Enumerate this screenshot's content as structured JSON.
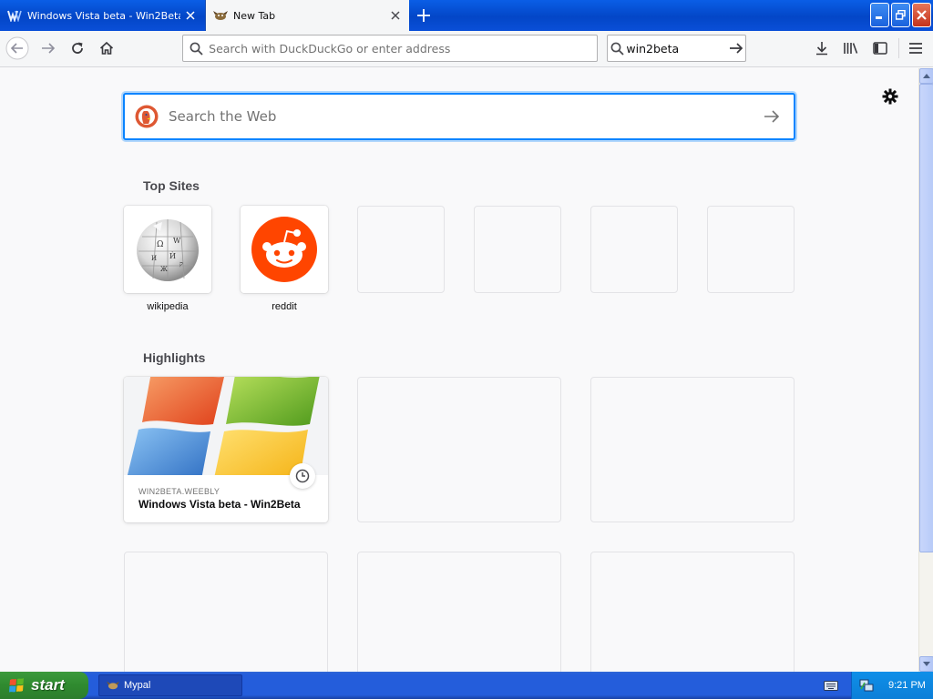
{
  "tabs": [
    {
      "label": "Windows Vista beta - Win2Beta",
      "active": false
    },
    {
      "label": "New Tab",
      "active": true
    }
  ],
  "toolbar": {
    "url_placeholder": "Search with DuckDuckGo or enter address",
    "search_value": "win2beta"
  },
  "newtab": {
    "search_placeholder": "Search the Web",
    "top_sites_heading": "Top Sites",
    "top_sites": [
      {
        "label": "wikipedia",
        "icon": "wikipedia-globe-icon"
      },
      {
        "label": "reddit",
        "icon": "reddit-icon"
      },
      {
        "label": ""
      },
      {
        "label": ""
      },
      {
        "label": ""
      },
      {
        "label": ""
      }
    ],
    "highlights_heading": "Highlights",
    "highlights": [
      {
        "host": "WIN2BETA.WEEBLY",
        "title": "Windows Vista beta - Win2Beta"
      }
    ]
  },
  "taskbar": {
    "start_label": "start",
    "task_label": "Mypal",
    "clock": "9:21 PM"
  },
  "colors": {
    "accent": "#0a84ff",
    "reddit": "#ff4500",
    "xp_taskbar": "#245ddb",
    "xp_start": "#3c9a3c"
  }
}
